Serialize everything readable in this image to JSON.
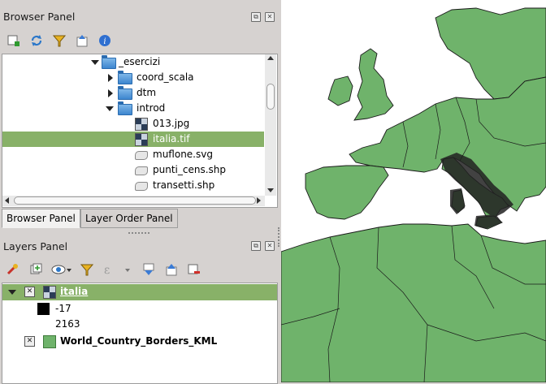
{
  "browser_panel": {
    "title": "Browser Panel",
    "toolbar": [
      "add-layer-icon",
      "refresh-icon",
      "filter-icon",
      "collapse-all-icon",
      "info-icon"
    ],
    "items": [
      {
        "label": "_esercizi",
        "kind": "folder",
        "expanded": true
      },
      {
        "label": "coord_scala",
        "kind": "folder",
        "expanded": false
      },
      {
        "label": "dtm",
        "kind": "folder",
        "expanded": false
      },
      {
        "label": "introd",
        "kind": "folder",
        "expanded": true
      },
      {
        "label": "013.jpg",
        "kind": "raster"
      },
      {
        "label": "italia.tif",
        "kind": "raster",
        "selected": true
      },
      {
        "label": "muflone.svg",
        "kind": "vector"
      },
      {
        "label": "punti_cens.shp",
        "kind": "vector"
      },
      {
        "label": "transetti.shp",
        "kind": "vector"
      }
    ]
  },
  "tabs": [
    "Browser Panel",
    "Layer Order Panel"
  ],
  "layers_panel": {
    "title": "Layers Panel",
    "toolbar": [
      "style-icon",
      "add-group-icon",
      "visibility-icon",
      "filter-icon",
      "expression-filter-icon",
      "expand-icon",
      "collapse-icon",
      "remove-layer-icon"
    ],
    "layers": [
      {
        "name": "italia",
        "legend": [
          {
            "label": "-17",
            "color": "#000000"
          },
          {
            "label": "2163",
            "color": "#ffffff"
          }
        ]
      },
      {
        "name": "World_Country_Borders_KML",
        "color": "#6fb36b"
      }
    ]
  },
  "map": {
    "land_color": "#6fb36b",
    "sea_color": "#ffffff"
  }
}
